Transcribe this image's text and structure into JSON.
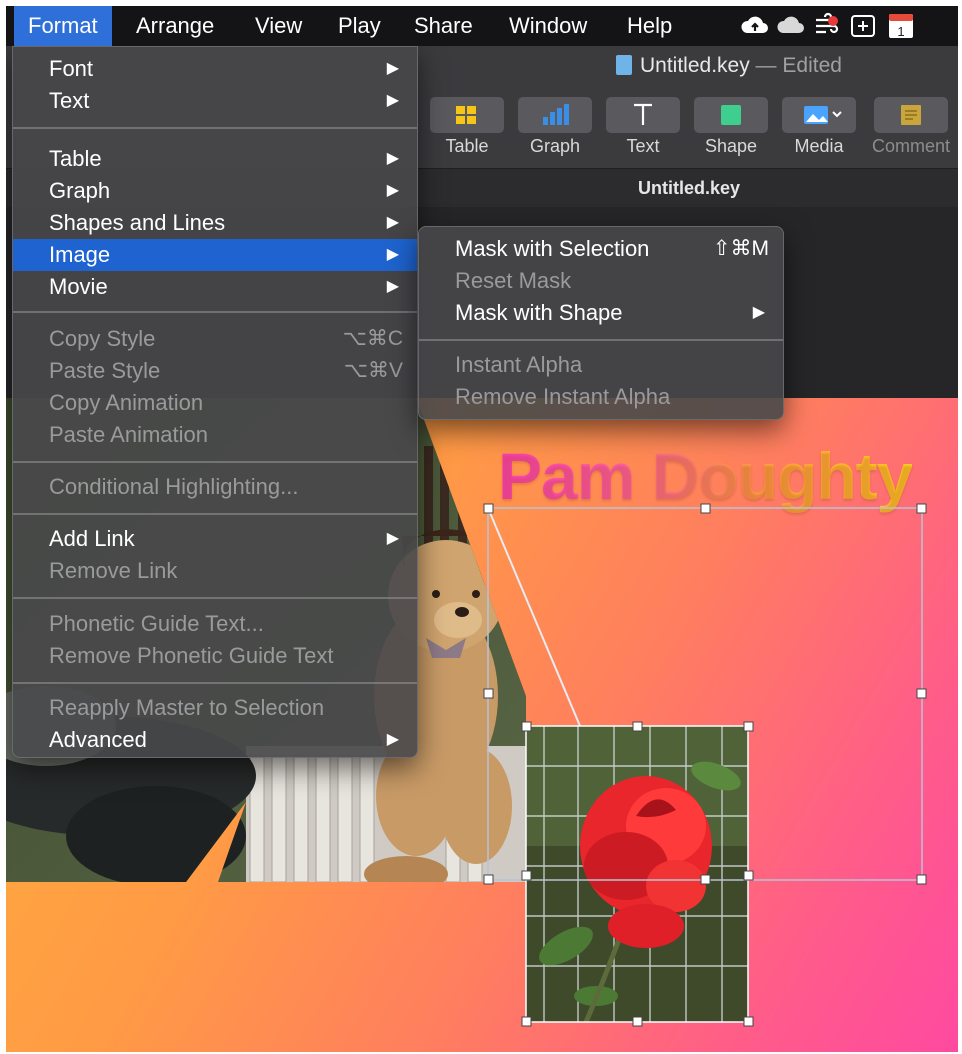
{
  "menubar": {
    "items": [
      "Format",
      "Arrange",
      "View",
      "Play",
      "Share",
      "Window",
      "Help"
    ],
    "active": "Format",
    "status_icons": [
      "cloud-upload-icon",
      "cloud-icon",
      "wind-notification-icon",
      "screenshot-icon",
      "calendar-icon"
    ],
    "calendar_day": "1"
  },
  "window": {
    "doc_title": "Untitled.key",
    "doc_state": "Edited",
    "tab_title": "Untitled.key"
  },
  "toolbar": {
    "buttons": [
      {
        "label": "Table",
        "icon": "table-icon",
        "color": "#f5c518"
      },
      {
        "label": "Graph",
        "icon": "graph-icon",
        "color": "#3a8ee6"
      },
      {
        "label": "Text",
        "icon": "text-icon",
        "color": "#ffffff"
      },
      {
        "label": "Shape",
        "icon": "shape-icon",
        "color": "#3ecf8e"
      },
      {
        "label": "Media",
        "icon": "media-icon",
        "color": "#4aa3ff"
      },
      {
        "label": "Comment",
        "icon": "comment-icon",
        "color": "#c9a53c",
        "disabled": true
      }
    ]
  },
  "slide": {
    "title": "Pam Doughty"
  },
  "format_menu": {
    "items": [
      {
        "label": "Font",
        "submenu": true
      },
      {
        "label": "Text",
        "submenu": true
      },
      {
        "separator": true
      },
      {
        "label": "Table",
        "submenu": true
      },
      {
        "label": "Graph",
        "submenu": true
      },
      {
        "label": "Shapes and Lines",
        "submenu": true
      },
      {
        "label": "Image",
        "submenu": true,
        "highlighted": true
      },
      {
        "label": "Movie",
        "submenu": true
      },
      {
        "separator": true
      },
      {
        "label": "Copy Style",
        "shortcut": "⌥⌘C",
        "disabled": true
      },
      {
        "label": "Paste Style",
        "shortcut": "⌥⌘V",
        "disabled": true
      },
      {
        "label": "Copy Animation",
        "disabled": true
      },
      {
        "label": "Paste Animation",
        "disabled": true
      },
      {
        "separator": true
      },
      {
        "label": "Conditional Highlighting...",
        "disabled": true
      },
      {
        "separator": true
      },
      {
        "label": "Add Link",
        "submenu": true
      },
      {
        "label": "Remove Link",
        "disabled": true
      },
      {
        "separator": true
      },
      {
        "label": "Phonetic Guide Text...",
        "disabled": true
      },
      {
        "label": "Remove Phonetic Guide Text",
        "disabled": true
      },
      {
        "separator": true
      },
      {
        "label": "Reapply Master to Selection",
        "disabled": true
      },
      {
        "label": "Advanced",
        "submenu": true
      }
    ]
  },
  "image_submenu": {
    "items": [
      {
        "label": "Mask with Selection",
        "shortcut": "⇧⌘M"
      },
      {
        "label": "Reset Mask",
        "disabled": true
      },
      {
        "label": "Mask with Shape",
        "submenu": true
      },
      {
        "separator": true
      },
      {
        "label": "Instant Alpha",
        "disabled": true
      },
      {
        "label": "Remove Instant Alpha",
        "disabled": true
      }
    ]
  },
  "colors": {
    "menu_highlight": "#1e63cf",
    "menubar_active": "#2e6fd9",
    "title_gradient": [
      "#ff3fb4",
      "#ffa23c",
      "#ffcf1f"
    ]
  }
}
